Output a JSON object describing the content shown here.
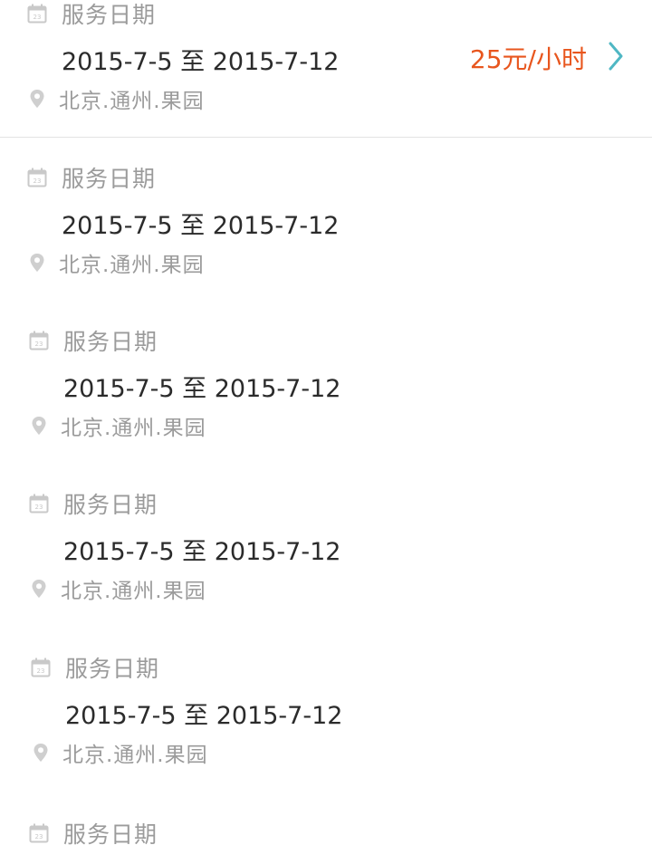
{
  "colors": {
    "accent_price": "#e8561e",
    "chevron": "#4fb7c4",
    "label_gray": "#9b9b9b",
    "text_dark": "#2b2b2b"
  },
  "items": [
    {
      "label": "服务日期",
      "date_range": "2015-7-5 至 2015-7-12",
      "location": "北京.通州.果园",
      "price": "25元/小时"
    },
    {
      "label": "服务日期",
      "date_range": "2015-7-5 至 2015-7-12",
      "location": "北京.通州.果园"
    },
    {
      "label": "服务日期",
      "date_range": "2015-7-5 至 2015-7-12",
      "location": "北京.通州.果园"
    },
    {
      "label": "服务日期",
      "date_range": "2015-7-5 至 2015-7-12",
      "location": "北京.通州.果园"
    },
    {
      "label": "服务日期",
      "date_range": "2015-7-5 至 2015-7-12",
      "location": "北京.通州.果园"
    },
    {
      "label": "服务日期"
    }
  ],
  "icons": {
    "calendar": "calendar-icon",
    "pin": "location-pin-icon",
    "chevron": "chevron-right-icon"
  }
}
